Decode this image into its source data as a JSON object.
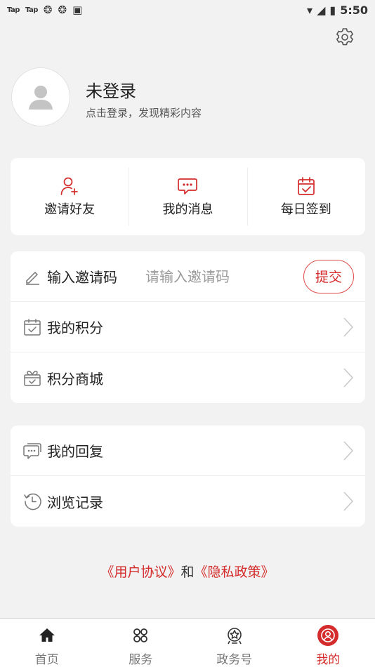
{
  "status_bar": {
    "left_labels": [
      "Tap",
      "Tap"
    ],
    "time": "5:50"
  },
  "profile": {
    "title": "未登录",
    "subtitle": "点击登录，发现精彩内容"
  },
  "quick_actions": [
    {
      "label": "邀请好友",
      "icon": "add-user-icon"
    },
    {
      "label": "我的消息",
      "icon": "message-icon"
    },
    {
      "label": "每日签到",
      "icon": "calendar-check-icon"
    }
  ],
  "invite": {
    "label": "输入邀请码",
    "placeholder": "请输入邀请码",
    "value": "",
    "submit_label": "提交"
  },
  "menu_group_1": [
    {
      "label": "我的积分",
      "icon": "points-calendar-icon"
    },
    {
      "label": "积分商城",
      "icon": "gift-box-icon"
    }
  ],
  "menu_group_2": [
    {
      "label": "我的回复",
      "icon": "reply-bubble-icon"
    },
    {
      "label": "浏览记录",
      "icon": "history-clock-icon"
    }
  ],
  "legal": {
    "user_agreement": "《用户协议》",
    "connector": "和",
    "privacy_policy": "《隐私政策》"
  },
  "tabbar": [
    {
      "label": "首页",
      "icon": "home-icon"
    },
    {
      "label": "服务",
      "icon": "services-grid-icon"
    },
    {
      "label": "政务号",
      "icon": "gov-emblem-icon"
    },
    {
      "label": "我的",
      "icon": "profile-icon",
      "active": true
    }
  ],
  "colors": {
    "accent": "#d42c2c",
    "background": "#f2f2f2",
    "card": "#ffffff"
  }
}
